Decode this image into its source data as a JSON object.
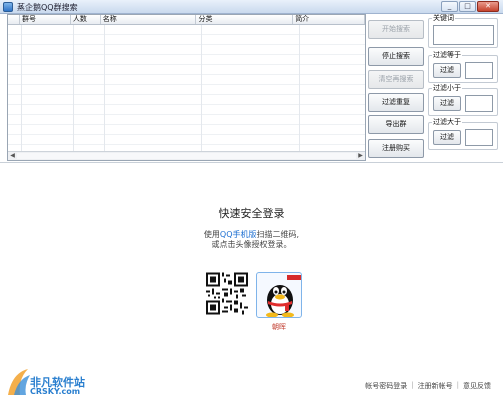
{
  "window": {
    "title": "蒸企鹅QQ群搜索",
    "buttons": [
      "_",
      "□",
      "✕"
    ]
  },
  "grid": {
    "columns": [
      "",
      "群号",
      "人数",
      "名称",
      "分类",
      "简介"
    ]
  },
  "actions": {
    "start_search": "开始搜索",
    "stop_search": "停止搜索",
    "clear_list": "清空再搜索",
    "filter_dedupe": "过滤重复",
    "export_groups": "导出群",
    "register_buy": "注册购买"
  },
  "filters": {
    "keyword_label": "关键词",
    "keyword_value": "",
    "equals_label": "过滤等于",
    "less_label": "过滤小于",
    "greater_label": "过滤大于",
    "filter_button": "过滤",
    "equals_value": "",
    "less_value": "",
    "greater_value": ""
  },
  "login": {
    "title": "快速安全登录",
    "line1_pre": "使用",
    "line1_link": "QQ手机版",
    "line1_post": "扫描二维码,",
    "line2": "或点击头像授权登录。",
    "avatar_name": "朝晖"
  },
  "footer": {
    "link_password": "帐号密码登录",
    "link_register": "注册新帐号",
    "link_feedback": "意见反馈"
  },
  "watermark": {
    "name": "非凡软件站",
    "domain": "CRSKY.com"
  }
}
